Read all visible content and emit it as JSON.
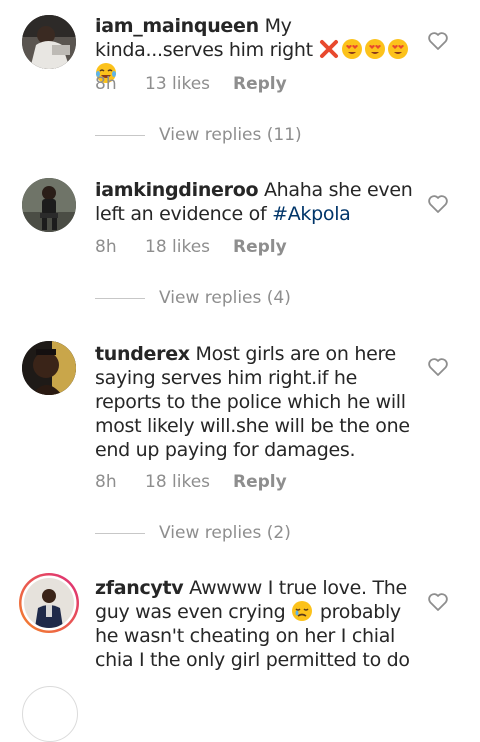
{
  "comments": [
    {
      "username": "iam_mainqueen",
      "text": "My kinda...serves him right",
      "time": "8h",
      "likes": "13 likes",
      "reply": "Reply",
      "view_replies": "View replies (11)"
    },
    {
      "username": "iamkingdineroo",
      "text": "Ahaha she even left an evidence of",
      "hashtag": "#Akpola",
      "time": "8h",
      "likes": "18 likes",
      "reply": "Reply",
      "view_replies": "View replies (4)"
    },
    {
      "username": "tunderex",
      "text": "Most girls are on here saying serves him right.if he reports to the police which he will most likely will.she will be the one end up paying for damages.",
      "time": "8h",
      "likes": "18 likes",
      "reply": "Reply",
      "view_replies": "View replies (2)"
    },
    {
      "username": "zfancytv",
      "text_before_emoji": "Awwww I true love. The guy was even crying",
      "text_after_emoji": "probably he wasn't cheating on her I chial chia I the only girl permitted to do"
    }
  ],
  "icons": {
    "like": "heart-outline-icon",
    "emoji_cross": "cross-mark-emoji",
    "emoji_heart_eyes": "heart-eyes-emoji",
    "emoji_joy": "tears-of-joy-emoji",
    "emoji_crying": "crying-face-emoji"
  },
  "colors": {
    "text": "#262626",
    "meta": "#8e8e8e",
    "hashtag": "#003569",
    "story_ring_start": "#f58529",
    "story_ring_end": "#dd2a7b"
  }
}
